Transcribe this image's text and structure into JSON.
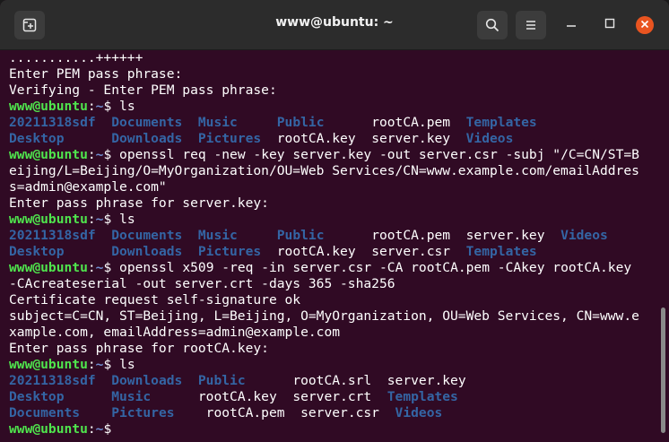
{
  "window": {
    "title": "www@ubuntu: ~",
    "icons": {
      "new_tab": "new-tab-icon",
      "search": "search-icon",
      "menu": "hamburger-menu-icon",
      "minimize": "minimize-icon",
      "maximize": "maximize-icon",
      "close": "close-icon"
    }
  },
  "colors": {
    "background": "#300a24",
    "prompt_user": "#4fe54d",
    "prompt_path": "#6f8fd1",
    "directory": "#3465a4",
    "close_button": "#e95420"
  },
  "terminal": {
    "prompt_user": "www@ubuntu",
    "prompt_path": "~",
    "prompt_sep": ":",
    "prompt_end": "$",
    "lines": [
      [
        "...........++++++"
      ],
      [
        "Enter PEM pass phrase:"
      ],
      [
        "Verifying - Enter PEM pass phrase:"
      ],
      [
        "$P",
        " ls"
      ],
      [
        "$D20211318sdf",
        "  ",
        "$DDocuments",
        "  ",
        "$DMusic",
        "     ",
        "$DPublic",
        "      rootCA.pem  ",
        "$DTemplates"
      ],
      [
        "$DDesktop",
        "      ",
        "$DDownloads",
        "  ",
        "$DPictures",
        "  rootCA.key  server.key  ",
        "$DVideos"
      ],
      [
        "$P",
        " openssl req -new -key server.key -out server.csr -subj \"/C=CN/ST=B"
      ],
      [
        "eijing/L=Beijing/O=MyOrganization/OU=Web Services/CN=www.example.com/emailAddres"
      ],
      [
        "s=admin@example.com\""
      ],
      [
        "Enter pass phrase for server.key:"
      ],
      [
        "$P",
        " ls"
      ],
      [
        "$D20211318sdf",
        "  ",
        "$DDocuments",
        "  ",
        "$DMusic",
        "     ",
        "$DPublic",
        "      rootCA.pem  server.key  ",
        "$DVideos"
      ],
      [
        "$DDesktop",
        "      ",
        "$DDownloads",
        "  ",
        "$DPictures",
        "  rootCA.key  server.csr  ",
        "$DTemplates"
      ],
      [
        "$P",
        " openssl x509 -req -in server.csr -CA rootCA.pem -CAkey rootCA.key"
      ],
      [
        "-CAcreateserial -out server.crt -days 365 -sha256"
      ],
      [
        "Certificate request self-signature ok"
      ],
      [
        "subject=C=CN, ST=Beijing, L=Beijing, O=MyOrganization, OU=Web Services, CN=www.e"
      ],
      [
        "xample.com, emailAddress=admin@example.com"
      ],
      [
        "Enter pass phrase for rootCA.key:"
      ],
      [
        "$P",
        " ls"
      ],
      [
        "$D20211318sdf",
        "  ",
        "$DDownloads",
        "  ",
        "$DPublic",
        "      rootCA.srl  server.key"
      ],
      [
        "$DDesktop",
        "      ",
        "$DMusic",
        "      rootCA.key  server.crt  ",
        "$DTemplates"
      ],
      [
        "$DDocuments",
        "    ",
        "$DPictures",
        "    rootCA.pem  server.csr  ",
        "$DVideos"
      ],
      [
        "$P",
        " "
      ]
    ]
  }
}
